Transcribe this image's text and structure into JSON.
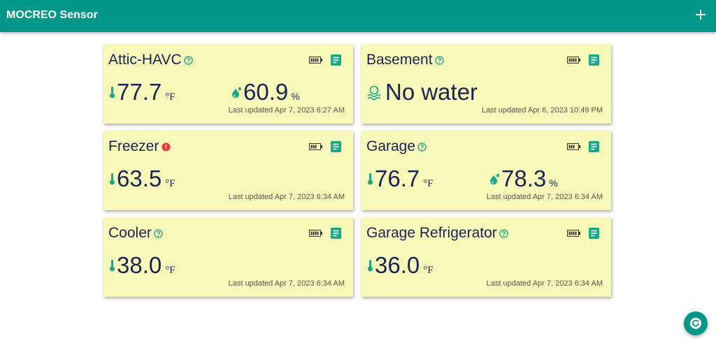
{
  "app": {
    "title": "MOCREO Sensor"
  },
  "colors": {
    "appbar": "#009688",
    "card_bg": "#f8f8b8",
    "text": "#1a2357",
    "accent": "#18a889",
    "warning": "#e53935"
  },
  "sensors": [
    {
      "name": "Attic-HAVC",
      "status_icon": "help-icon",
      "temperature": "77.7",
      "temp_unit": "°F",
      "humidity": "60.9",
      "humidity_unit": "%",
      "updated": "Last updated Apr 7, 2023 6:27 AM"
    },
    {
      "name": "Basement",
      "status_icon": "help-icon",
      "water_status": "No water",
      "updated": "Last updated Apr 6, 2023 10:49 PM"
    },
    {
      "name": "Freezer",
      "status_icon": "warning-icon",
      "temperature": "63.5",
      "temp_unit": "°F",
      "updated": "Last updated Apr 7, 2023 6:34 AM"
    },
    {
      "name": "Garage",
      "status_icon": "help-icon",
      "temperature": "76.7",
      "temp_unit": "°F",
      "humidity": "78.3",
      "humidity_unit": "%",
      "updated": "Last updated Apr 7, 2023 6:34 AM"
    },
    {
      "name": "Cooler",
      "status_icon": "help-icon",
      "temperature": "38.0",
      "temp_unit": "°F",
      "updated": "Last updated Apr 7, 2023 6:34 AM"
    },
    {
      "name": "Garage Refrigerator",
      "status_icon": "help-icon",
      "temperature": "36.0",
      "temp_unit": "°F",
      "updated": "Last updated Apr 7, 2023 6:34 AM"
    }
  ]
}
